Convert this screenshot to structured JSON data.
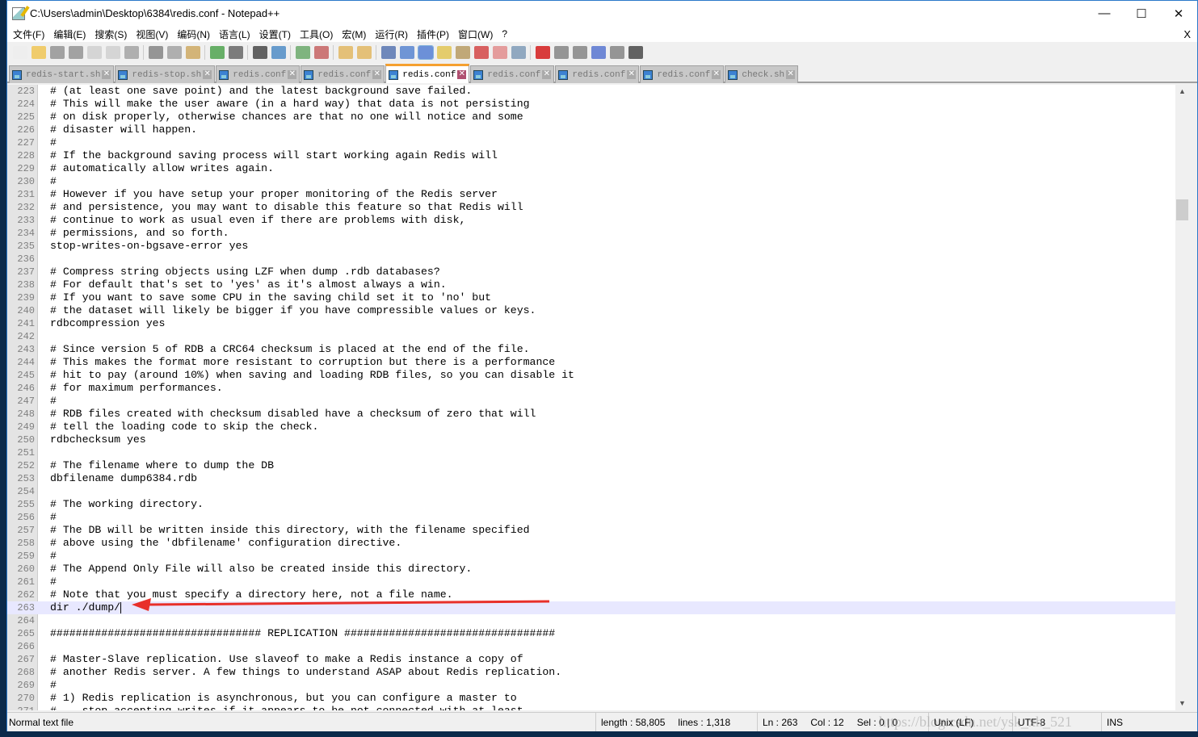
{
  "window": {
    "title": "C:\\Users\\admin\\Desktop\\6384\\redis.conf - Notepad++",
    "controls": [
      "—",
      "☐",
      "✕"
    ]
  },
  "menu": {
    "items": [
      "文件(F)",
      "编辑(E)",
      "搜索(S)",
      "视图(V)",
      "编码(N)",
      "语言(L)",
      "设置(T)",
      "工具(O)",
      "宏(M)",
      "运行(R)",
      "插件(P)",
      "窗口(W)",
      "?"
    ],
    "close": "X"
  },
  "toolbar": {
    "buttons": [
      "new",
      "open",
      "save",
      "save-all",
      "close",
      "close-all",
      "print",
      "cut",
      "copy",
      "paste",
      "undo",
      "redo",
      "find",
      "replace",
      "zoom-in",
      "zoom-out",
      "sync-v",
      "sync-h",
      "word-wrap",
      "show-all-chars",
      "indent-guide",
      "udl",
      "doc-map",
      "function-list",
      "folder-workspace",
      "monitor",
      "record-macro",
      "stop-record",
      "play-macro",
      "run-macro-multiple",
      "save-macro",
      "spell-check"
    ]
  },
  "tabs": [
    {
      "label": "redis-start.sh",
      "active": false
    },
    {
      "label": "redis-stop.sh",
      "active": false
    },
    {
      "label": "redis.conf",
      "active": false
    },
    {
      "label": "redis.conf",
      "active": false
    },
    {
      "label": "redis.conf",
      "active": true
    },
    {
      "label": "redis.conf",
      "active": false
    },
    {
      "label": "redis.conf",
      "active": false
    },
    {
      "label": "redis.conf",
      "active": false
    },
    {
      "label": "check.sh",
      "active": false
    }
  ],
  "editor": {
    "current_line": 263,
    "lines": [
      {
        "n": "223",
        "t": "# (at least one save point) and the latest background save failed."
      },
      {
        "n": "224",
        "t": "# This will make the user aware (in a hard way) that data is not persisting"
      },
      {
        "n": "225",
        "t": "# on disk properly, otherwise chances are that no one will notice and some"
      },
      {
        "n": "226",
        "t": "# disaster will happen."
      },
      {
        "n": "227",
        "t": "#"
      },
      {
        "n": "228",
        "t": "# If the background saving process will start working again Redis will"
      },
      {
        "n": "229",
        "t": "# automatically allow writes again."
      },
      {
        "n": "230",
        "t": "#"
      },
      {
        "n": "231",
        "t": "# However if you have setup your proper monitoring of the Redis server"
      },
      {
        "n": "232",
        "t": "# and persistence, you may want to disable this feature so that Redis will"
      },
      {
        "n": "233",
        "t": "# continue to work as usual even if there are problems with disk,"
      },
      {
        "n": "234",
        "t": "# permissions, and so forth."
      },
      {
        "n": "235",
        "t": "stop-writes-on-bgsave-error yes"
      },
      {
        "n": "236",
        "t": ""
      },
      {
        "n": "237",
        "t": "# Compress string objects using LZF when dump .rdb databases?"
      },
      {
        "n": "238",
        "t": "# For default that's set to 'yes' as it's almost always a win."
      },
      {
        "n": "239",
        "t": "# If you want to save some CPU in the saving child set it to 'no' but"
      },
      {
        "n": "240",
        "t": "# the dataset will likely be bigger if you have compressible values or keys."
      },
      {
        "n": "241",
        "t": "rdbcompression yes"
      },
      {
        "n": "242",
        "t": ""
      },
      {
        "n": "243",
        "t": "# Since version 5 of RDB a CRC64 checksum is placed at the end of the file."
      },
      {
        "n": "244",
        "t": "# This makes the format more resistant to corruption but there is a performance"
      },
      {
        "n": "245",
        "t": "# hit to pay (around 10%) when saving and loading RDB files, so you can disable it"
      },
      {
        "n": "246",
        "t": "# for maximum performances."
      },
      {
        "n": "247",
        "t": "#"
      },
      {
        "n": "248",
        "t": "# RDB files created with checksum disabled have a checksum of zero that will"
      },
      {
        "n": "249",
        "t": "# tell the loading code to skip the check."
      },
      {
        "n": "250",
        "t": "rdbchecksum yes"
      },
      {
        "n": "251",
        "t": ""
      },
      {
        "n": "252",
        "t": "# The filename where to dump the DB"
      },
      {
        "n": "253",
        "t": "dbfilename dump6384.rdb"
      },
      {
        "n": "254",
        "t": ""
      },
      {
        "n": "255",
        "t": "# The working directory."
      },
      {
        "n": "256",
        "t": "#"
      },
      {
        "n": "257",
        "t": "# The DB will be written inside this directory, with the filename specified"
      },
      {
        "n": "258",
        "t": "# above using the 'dbfilename' configuration directive."
      },
      {
        "n": "259",
        "t": "#"
      },
      {
        "n": "260",
        "t": "# The Append Only File will also be created inside this directory."
      },
      {
        "n": "261",
        "t": "#"
      },
      {
        "n": "262",
        "t": "# Note that you must specify a directory here, not a file name."
      },
      {
        "n": "263",
        "t": "dir ./dump/"
      },
      {
        "n": "264",
        "t": ""
      },
      {
        "n": "265",
        "t": "################################# REPLICATION #################################"
      },
      {
        "n": "266",
        "t": ""
      },
      {
        "n": "267",
        "t": "# Master-Slave replication. Use slaveof to make a Redis instance a copy of"
      },
      {
        "n": "268",
        "t": "# another Redis server. A few things to understand ASAP about Redis replication."
      },
      {
        "n": "269",
        "t": "#"
      },
      {
        "n": "270",
        "t": "# 1) Redis replication is asynchronous, but you can configure a master to"
      },
      {
        "n": "271",
        "t": "#    stop accepting writes if it appears to be not connected with at least"
      }
    ]
  },
  "annotation": {
    "arrow_color": "#e8302a"
  },
  "status": {
    "file_type": "Normal text file",
    "length": "length : 58,805",
    "lines": "lines : 1,318",
    "ln": "Ln : 263",
    "col": "Col : 12",
    "sel": "Sel : 0 | 0",
    "eol": "Unix (LF)",
    "encoding": "UTF-8",
    "mode": "INS",
    "watermark": "https://blog.csdn.net/ysk_xh_521"
  }
}
